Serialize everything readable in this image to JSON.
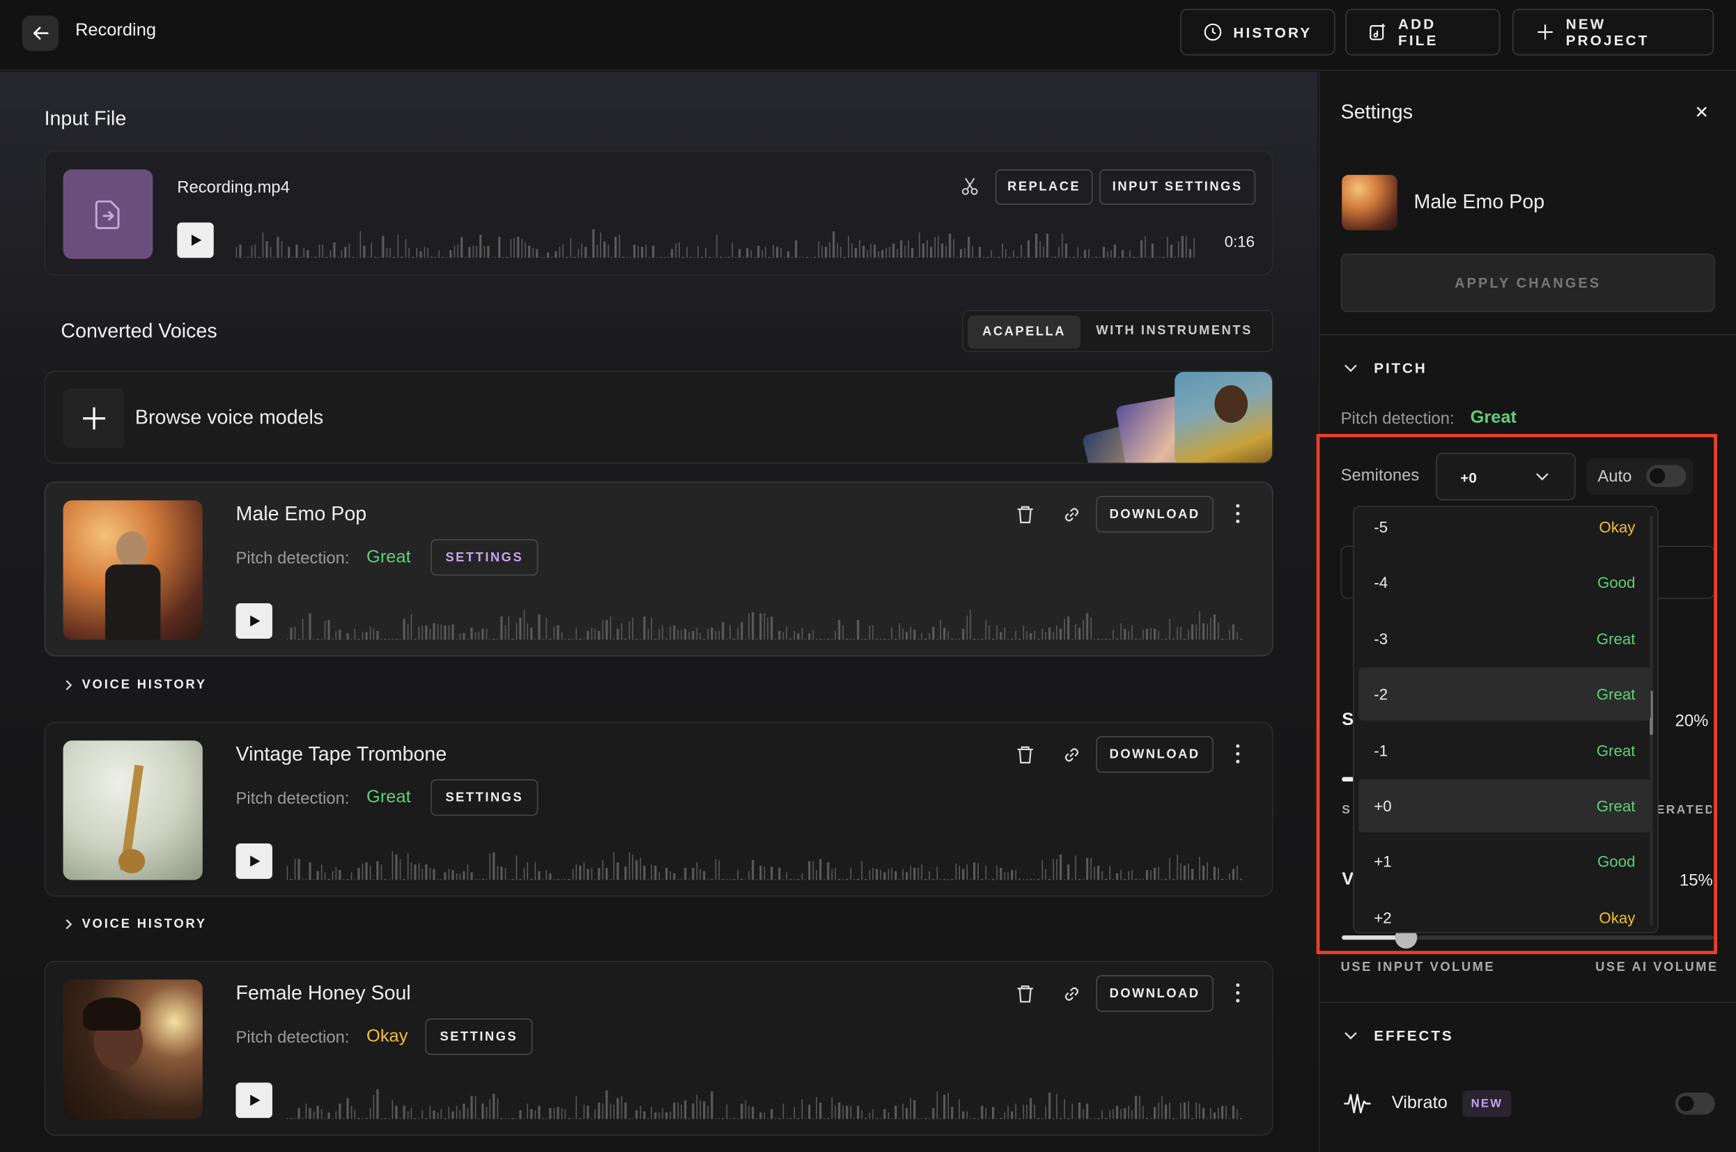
{
  "header": {
    "title": "Recording",
    "history_label": "HISTORY",
    "add_file_label": "ADD FILE",
    "new_project_label": "NEW PROJECT"
  },
  "input_file": {
    "section_title": "Input File",
    "file_name": "Recording.mp4",
    "replace_label": "REPLACE",
    "input_settings_label": "INPUT SETTINGS",
    "duration": "0:16"
  },
  "converted": {
    "section_title": "Converted Voices",
    "tabs": [
      "ACAPELLA",
      "WITH INSTRUMENTS"
    ],
    "active_tab": "ACAPELLA",
    "browse_label": "Browse voice models",
    "pitch_label": "Pitch detection:",
    "settings_label": "SETTINGS",
    "download_label": "DOWNLOAD",
    "voice_history_label": "VOICE HISTORY",
    "voices": [
      {
        "name": "Male Emo Pop",
        "pitch": "Great"
      },
      {
        "name": "Vintage Tape Trombone",
        "pitch": "Great"
      },
      {
        "name": "Female Honey Soul",
        "pitch": "Okay"
      }
    ]
  },
  "settings": {
    "title": "Settings",
    "model_name": "Male Emo Pop",
    "apply_label": "APPLY CHANGES",
    "pitch_header": "PITCH",
    "pitch_detection_label": "Pitch detection:",
    "pitch_detection_value": "Great",
    "semitones_label": "Semitones",
    "semitones_value": "+0",
    "auto_label": "Auto",
    "partial_s": "S",
    "partial_v": "V",
    "partial_pct1": "20%",
    "partial_pct2": "15%",
    "partial_erated": "ERATED",
    "partial_s2": "S",
    "use_input_volume": "USE INPUT VOLUME",
    "use_ai_volume": "USE AI VOLUME",
    "effects_header": "EFFECTS",
    "vibrato_label": "Vibrato",
    "new_badge": "NEW",
    "dropdown": [
      {
        "value": "-5",
        "quality": "Okay"
      },
      {
        "value": "-4",
        "quality": "Good"
      },
      {
        "value": "-3",
        "quality": "Great"
      },
      {
        "value": "-2",
        "quality": "Great"
      },
      {
        "value": "-1",
        "quality": "Great"
      },
      {
        "value": "+0",
        "quality": "Great"
      },
      {
        "value": "+1",
        "quality": "Good"
      },
      {
        "value": "+2",
        "quality": "Okay"
      }
    ]
  },
  "colors": {
    "great": "#5fd07a",
    "good": "#5fd07a",
    "okay": "#f2c12e",
    "highlight_box": "#e8402a"
  }
}
